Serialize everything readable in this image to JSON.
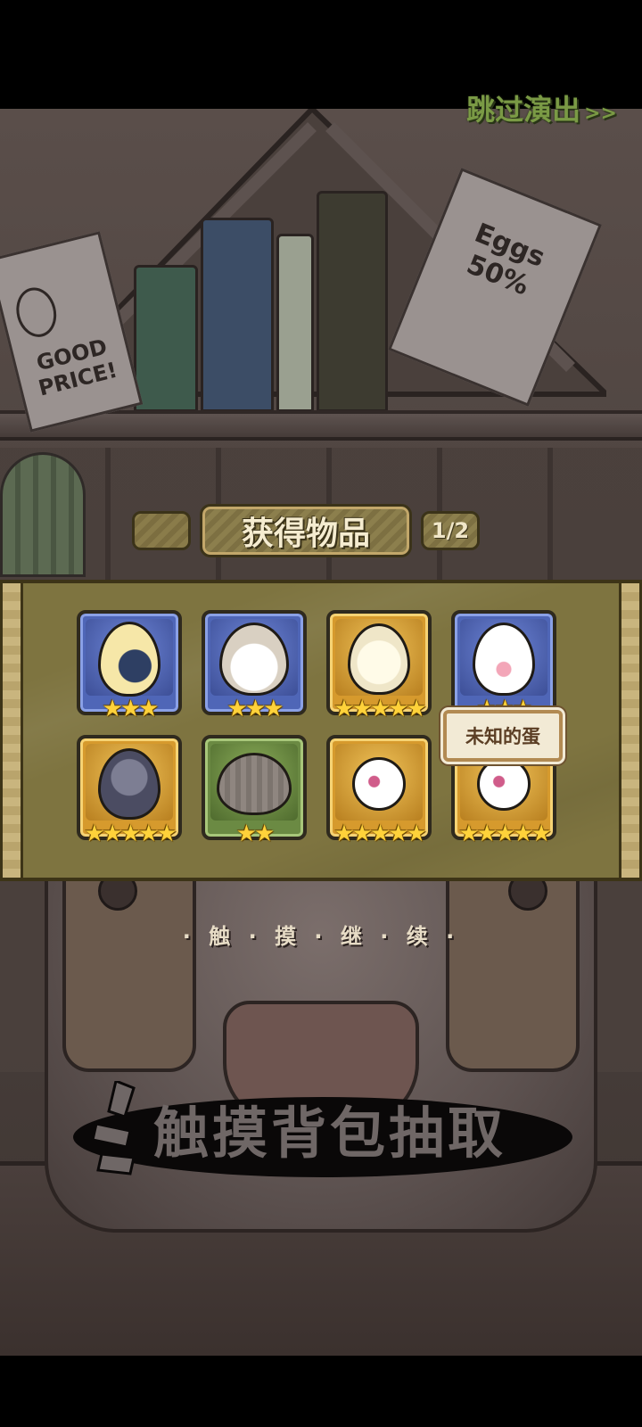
{
  "header": {
    "skip_label": "跳过演出",
    "skip_arrows": ">>"
  },
  "banner": {
    "title": "获得物品",
    "page_indicator": "1/2"
  },
  "items": [
    {
      "name": "yellow-blue-egg",
      "frame": "blue",
      "stars": "★★★",
      "star_count": 3
    },
    {
      "name": "owl-egg",
      "frame": "blue",
      "stars": "★★★",
      "star_count": 3
    },
    {
      "name": "winged-halo-egg",
      "frame": "gold",
      "stars": "★★★★★",
      "star_count": 5
    },
    {
      "name": "ribbon-egg",
      "frame": "blue",
      "stars": "★★★",
      "star_count": 3
    },
    {
      "name": "armored-cloud-egg",
      "frame": "gold",
      "stars": "★★★★★",
      "star_count": 5
    },
    {
      "name": "grey-owl-egg",
      "frame": "green",
      "stars": "★★",
      "star_count": 2
    },
    {
      "name": "bunny-creature",
      "frame": "gold",
      "stars": "★★★★★",
      "star_count": 5
    },
    {
      "name": "bunny-creature",
      "frame": "gold",
      "stars": "★★★★★",
      "star_count": 5
    }
  ],
  "tooltip": {
    "text": "未知的蛋"
  },
  "continue_hint": "· 触 · 摸 · 继 · 续 ·",
  "bottom_hint": "触摸背包抽取",
  "background_notes": {
    "left_note": "GOOD PRICE!",
    "right_note": "Eggs 50%"
  },
  "colors": {
    "panel": "#7e7440",
    "frame_blue": "#4f66b7",
    "frame_gold": "#d69a2d",
    "frame_green": "#6b8a43",
    "star": "#ffd23a",
    "skip_text": "#7a9a45"
  }
}
